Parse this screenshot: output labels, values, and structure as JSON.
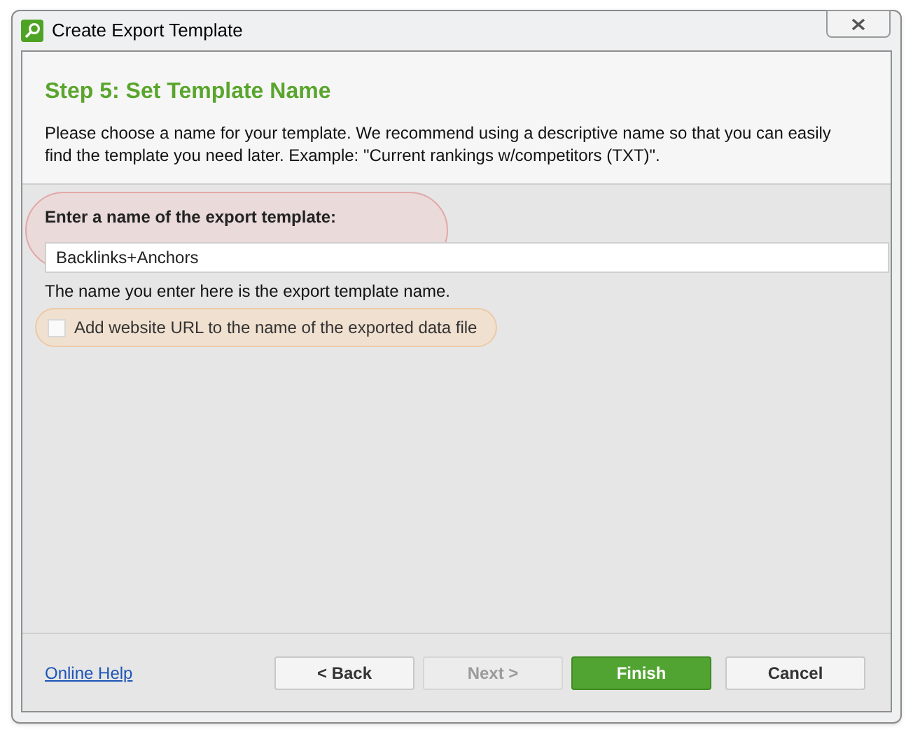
{
  "window": {
    "title": "Create Export Template"
  },
  "header": {
    "title": "Step 5: Set Template Name",
    "description": "Please choose a name for your template. We recommend using a descriptive name so that you can easily find the template you need later. Example: \"Current rankings w/competitors (TXT)\"."
  },
  "form": {
    "label": "Enter a name of the export template:",
    "value": "Backlinks+Anchors",
    "hint": "The name you enter here is the export template name.",
    "checkbox": {
      "label": "Add website URL to the name of the exported data file",
      "checked": false
    }
  },
  "footer": {
    "help_link": "Online Help",
    "buttons": [
      {
        "label": "< Back",
        "kind": "normal",
        "disabled": false
      },
      {
        "label": "Next >",
        "kind": "normal",
        "disabled": true
      },
      {
        "label": "Finish",
        "kind": "primary",
        "disabled": false
      },
      {
        "label": "Cancel",
        "kind": "normal",
        "disabled": false
      }
    ]
  }
}
